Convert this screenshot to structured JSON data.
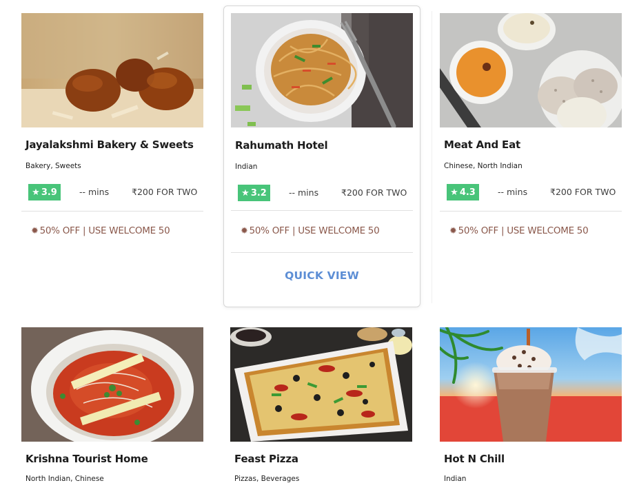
{
  "colors": {
    "rating_bg": "#48c479",
    "offer_text": "#8a584b",
    "quick_view": "#5d8ed5",
    "separator": "#e0e0e0"
  },
  "offer_icon": "offer-badge-icon",
  "rating_icon": "star-icon",
  "restaurants": [
    {
      "name": "Jayalakshmi Bakery & Sweets",
      "cuisine": "Bakery, Sweets",
      "rating": "3.9",
      "time": "-- mins",
      "price": "₹200 FOR TWO",
      "offer_discount": "50% OFF",
      "offer_code": "USE WELCOME 50"
    },
    {
      "name": "Rahumath Hotel",
      "cuisine": "Indian",
      "rating": "3.2",
      "time": "-- mins",
      "price": "₹200 FOR TWO",
      "offer_discount": "50% OFF",
      "offer_code": "USE WELCOME 50",
      "quick_view": "QUICK VIEW"
    },
    {
      "name": "Meat And Eat",
      "cuisine": "Chinese, North Indian",
      "rating": "4.3",
      "time": "-- mins",
      "price": "₹200 FOR TWO",
      "offer_discount": "50% OFF",
      "offer_code": "USE WELCOME 50"
    },
    {
      "name": "Krishna Tourist Home",
      "cuisine": "North Indian, Chinese"
    },
    {
      "name": "Feast Pizza",
      "cuisine": "Pizzas, Beverages"
    },
    {
      "name": "Hot N Chill",
      "cuisine": "Indian"
    }
  ]
}
